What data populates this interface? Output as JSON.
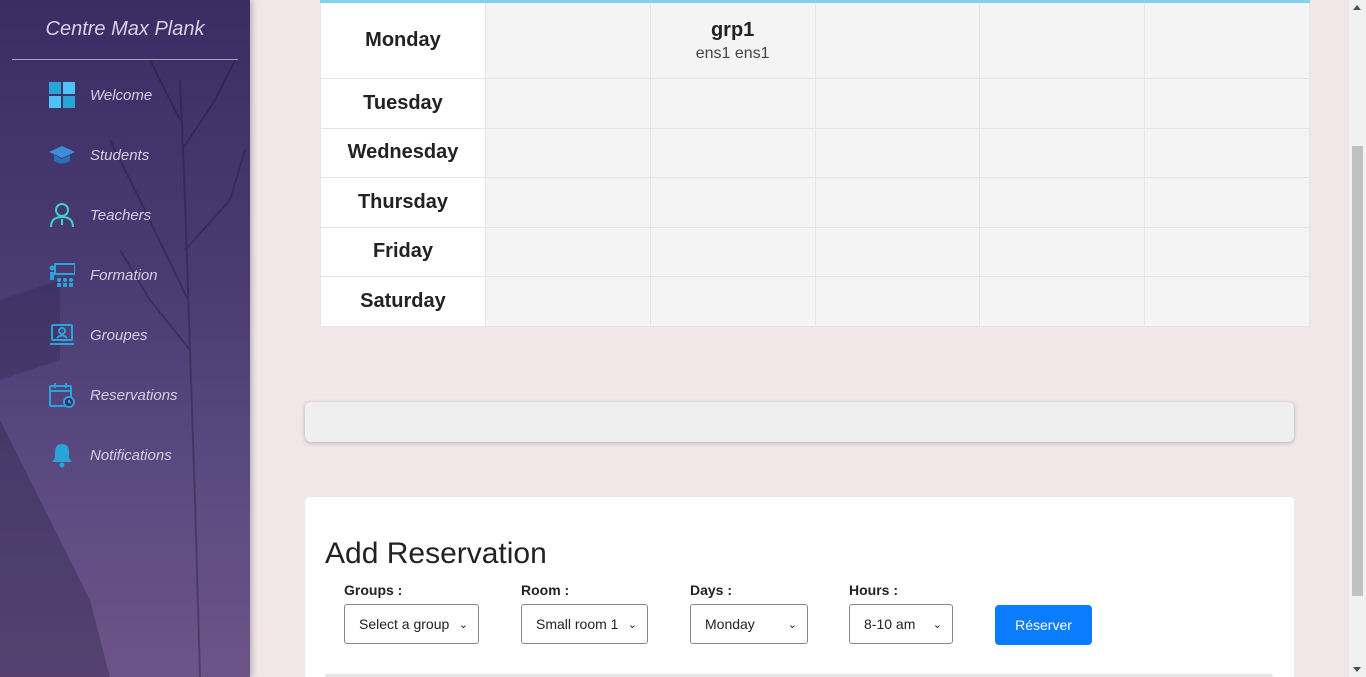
{
  "sidebar": {
    "brand": "Centre Max Plank",
    "items": [
      {
        "label": "Welcome",
        "icon": "dashboard-icon"
      },
      {
        "label": "Students",
        "icon": "graduation-cap-icon"
      },
      {
        "label": "Teachers",
        "icon": "teacher-icon"
      },
      {
        "label": "Formation",
        "icon": "training-icon"
      },
      {
        "label": "Groupes",
        "icon": "group-icon"
      },
      {
        "label": "Reservations",
        "icon": "calendar-icon"
      },
      {
        "label": "Notifications",
        "icon": "bell-icon"
      }
    ]
  },
  "timetable": {
    "days": [
      "Monday",
      "Tuesday",
      "Wednesday",
      "Thursday",
      "Friday",
      "Saturday"
    ],
    "entry": {
      "day": "Monday",
      "slot": 2,
      "group": "grp1",
      "teacher": "ens1 ens1"
    }
  },
  "reservation_form": {
    "title": "Add Reservation",
    "groups_label": "Groups :",
    "groups_value": "Select a group",
    "room_label": "Room :",
    "room_value": "Small room 1",
    "days_label": "Days :",
    "days_value": "Monday",
    "hours_label": "Hours :",
    "hours_value": "8-10 am",
    "submit_label": "Réserver"
  },
  "colors": {
    "sidebar": "#3b2d63",
    "accent": "#0a7cff",
    "table_top_border": "#7fd3ea",
    "page_bg": "#f1e7e8"
  }
}
